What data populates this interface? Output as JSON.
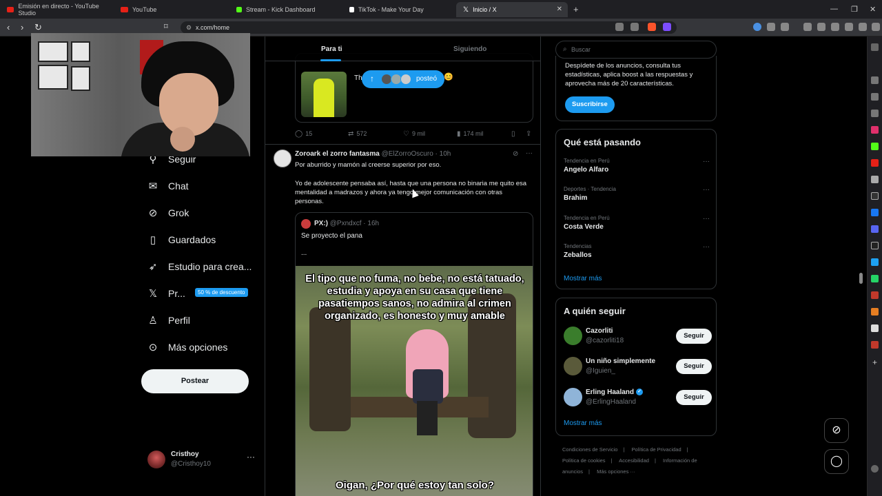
{
  "browser": {
    "tabs": [
      {
        "title": "Emisión en directo - YouTube Studio",
        "color": "#e62117"
      },
      {
        "title": "YouTube",
        "color": "#e62117"
      },
      {
        "title": "Stream - Kick Dashboard",
        "color": "#53fc18"
      },
      {
        "title": "TikTok - Make Your Day",
        "color": "#ffffff"
      },
      {
        "title": "Inicio / X",
        "color": "#ffffff"
      }
    ],
    "url": "x.com/home"
  },
  "nav": {
    "items": [
      {
        "label": "Seguir",
        "icon": "person-plus-icon"
      },
      {
        "label": "Chat",
        "icon": "mail-icon"
      },
      {
        "label": "Grok",
        "icon": "grok-icon"
      },
      {
        "label": "Guardados",
        "icon": "bookmark-icon"
      },
      {
        "label": "Estudio para crea...",
        "icon": "rocket-icon"
      },
      {
        "label": "Pr...",
        "icon": "x-logo-icon"
      },
      {
        "label": "Perfil",
        "icon": "profile-icon"
      },
      {
        "label": "Más opciones",
        "icon": "more-circle-icon"
      }
    ],
    "premium_badge": "50 % de descuento",
    "post_button": "Postear",
    "account": {
      "name": "Cristhoy",
      "handle": "@Cristhoy10"
    }
  },
  "timeline": {
    "tabs": [
      "Para ti",
      "Siguiendo"
    ],
    "quote1": {
      "text": "Tha",
      "posted_pill": "posteó"
    },
    "post1_actions": {
      "replies": "15",
      "reposts": "572",
      "likes": "9 mil",
      "views": "174 mil"
    },
    "post2": {
      "name": "Zoroark el zorro fantasma",
      "handle": "@ElZorroOscuro",
      "time": "· 10h",
      "line1": "Por aburrido y mamón al creerse superior por eso.",
      "line2": "Yo de adolescente pensaba así, hasta que una persona no binaria me quito esa mentalidad a madrazos y ahora ya tengo mejor comunicación con otras personas.",
      "quote": {
        "name": "PX:)",
        "handle": "@Pxndxcf",
        "time": "· 16h",
        "text": "Se proyecto el pana",
        "ellipsis": "...",
        "meme_caption": "El tipo que no fuma, no bebe, no está tatuado, estudia y apoya en su casa que tiene pasatiempos sanos, no admira al crimen organizado, es honesto y muy amable",
        "meme_caption2": "Oigan, ¿Por qué estoy tan solo?"
      }
    }
  },
  "right": {
    "search_placeholder": "Buscar",
    "promo_text": "Despídete de los anuncios, consulta tus estadísticas, aplica boost a las respuestas y aprovecha más de 20 características.",
    "subscribe": "Suscribirse",
    "trends_title": "Qué está pasando",
    "trends": [
      {
        "context": "Tendencia en Perú",
        "name": "Angelo Alfaro"
      },
      {
        "context": "Deportes · Tendencia",
        "name": "Brahim"
      },
      {
        "context": "Tendencia en Perú",
        "name": "Costa Verde"
      },
      {
        "context": "Tendencias",
        "name": "Zeballos"
      }
    ],
    "show_more": "Mostrar más",
    "follow_title": "A quién seguir",
    "follows": [
      {
        "name": "Cazorliti",
        "handle": "@cazorliti18",
        "button": "Seguir",
        "color": "#3a7d2c"
      },
      {
        "name": "Un niño simplemente",
        "handle": "@Iguien_",
        "button": "Seguir",
        "color": "#5a5a3a"
      },
      {
        "name": "Erling Haaland",
        "handle": "@ErlingHaaland",
        "button": "Seguir",
        "color": "#8fb4d8"
      }
    ],
    "footer": [
      "Condiciones de Servicio",
      "|",
      "Política de Privacidad",
      "|",
      "Política de cookies",
      "|",
      "Accesibilidad",
      "|",
      "Información de anuncios",
      "|",
      "Más opciones ···"
    ]
  },
  "colors": {
    "accent": "#1d9bf0",
    "background": "#000000"
  }
}
